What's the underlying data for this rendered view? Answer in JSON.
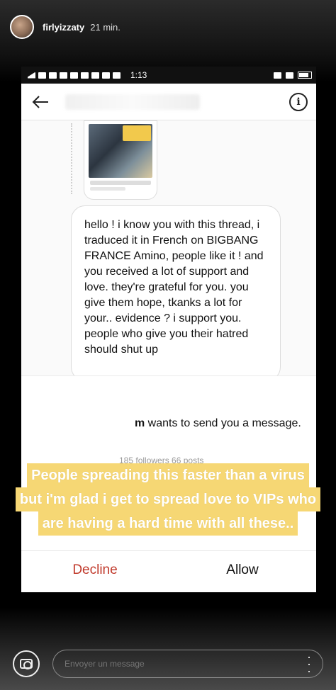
{
  "story": {
    "username": "firlyizzaty",
    "time_ago": "21 min.",
    "reply_placeholder": "Envoyer un message"
  },
  "phone": {
    "status_time": "1:13",
    "message": "hello ! i know you with this thread, i traduced it in French on BIGBANG FRANCE Amino, people like it ! and you received a lot of support and love. they're grateful for you. you give them hope, tkanks a lot for your.. evidence ? i support you. people who give you their hatred should shut up",
    "request_text_prefix": "m",
    "request_text": " wants to send you a message.",
    "followers_text": "185 followers 66 posts",
    "decline_label": "Decline",
    "allow_label": "Allow"
  },
  "sticker_lines": [
    "People spreading this faster than a virus",
    "but i'm glad i get to spread love to VIPs who",
    "are having a hard time with all these.."
  ]
}
